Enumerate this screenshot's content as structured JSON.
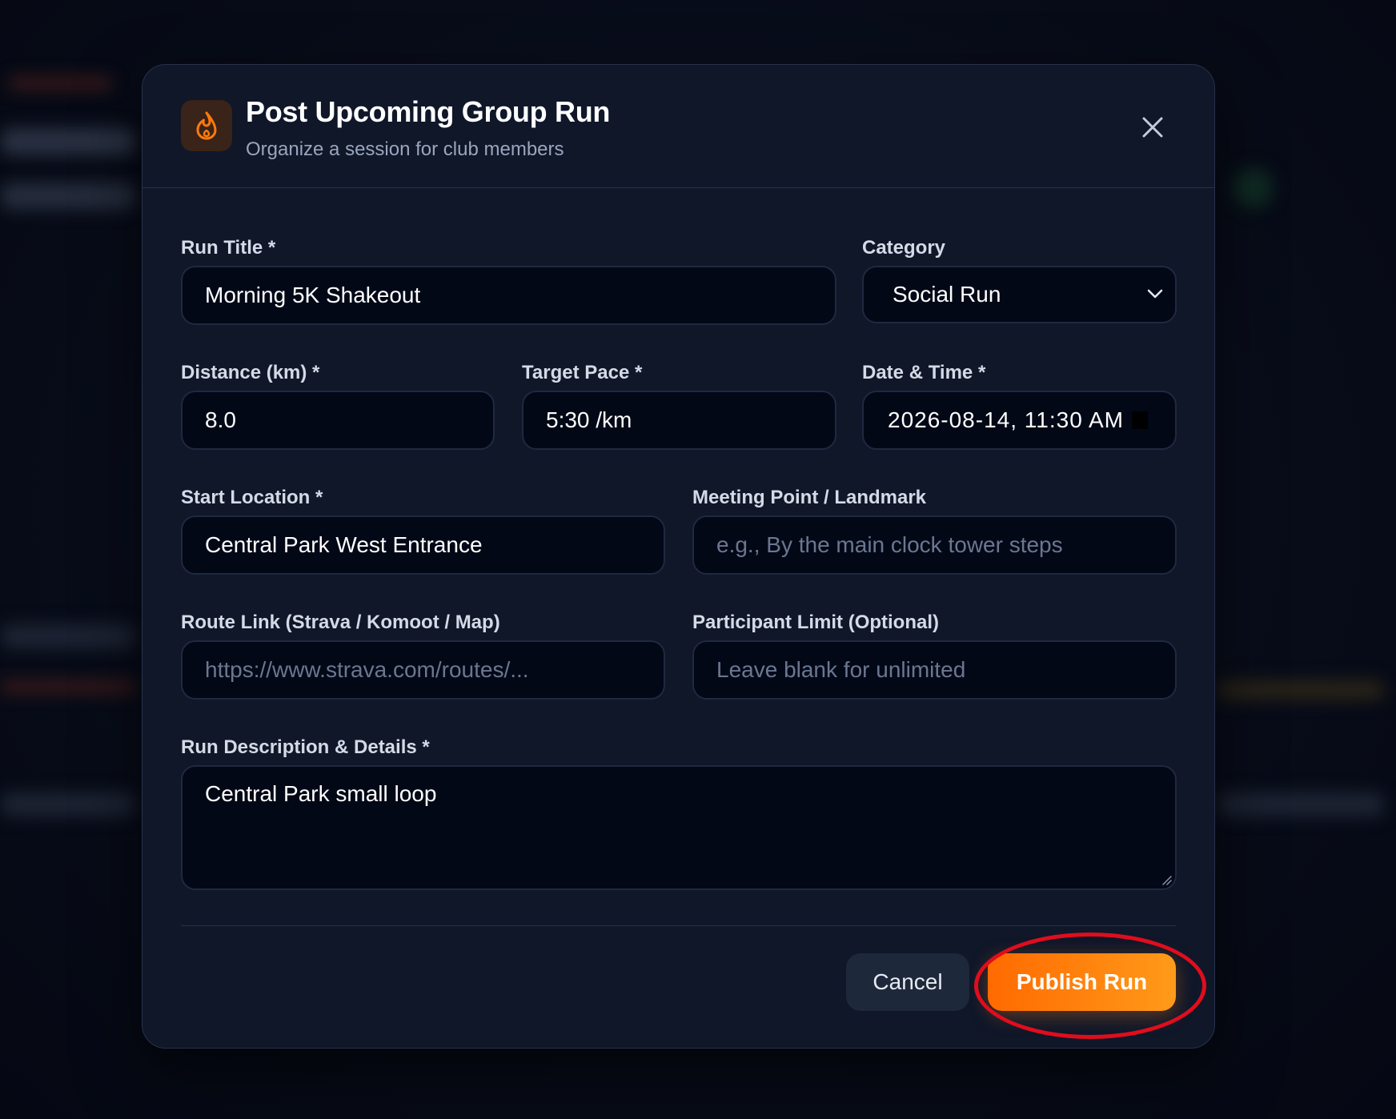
{
  "modal": {
    "title": "Post Upcoming Group Run",
    "subtitle": "Organize a session for club members",
    "icon": "flame-icon",
    "close_icon": "close-icon"
  },
  "form": {
    "run_title": {
      "label": "Run Title *",
      "value": "Morning 5K Shakeout"
    },
    "category": {
      "label": "Category",
      "value": "Social Run"
    },
    "distance": {
      "label": "Distance (km) *",
      "value": "8.0"
    },
    "target_pace": {
      "label": "Target Pace *",
      "value": "5:30 /km"
    },
    "date_time": {
      "label": "Date & Time *",
      "value": "2026-08-14, 11:30 AM"
    },
    "start_location": {
      "label": "Start Location *",
      "value": "Central Park West Entrance"
    },
    "meeting_point": {
      "label": "Meeting Point / Landmark",
      "placeholder": "e.g., By the main clock tower steps"
    },
    "route_link": {
      "label": "Route Link (Strava / Komoot / Map)",
      "placeholder": "https://www.strava.com/routes/..."
    },
    "participant_limit": {
      "label": "Participant Limit (Optional)",
      "placeholder": "Leave blank for unlimited"
    },
    "description": {
      "label": "Run Description & Details *",
      "value": "Central Park small loop"
    }
  },
  "actions": {
    "cancel_label": "Cancel",
    "publish_label": "Publish Run"
  },
  "colors": {
    "accent": "#ff7a0a",
    "annotation": "#e00d1c",
    "modal_bg": "#0f1729",
    "field_bg": "#030817"
  }
}
